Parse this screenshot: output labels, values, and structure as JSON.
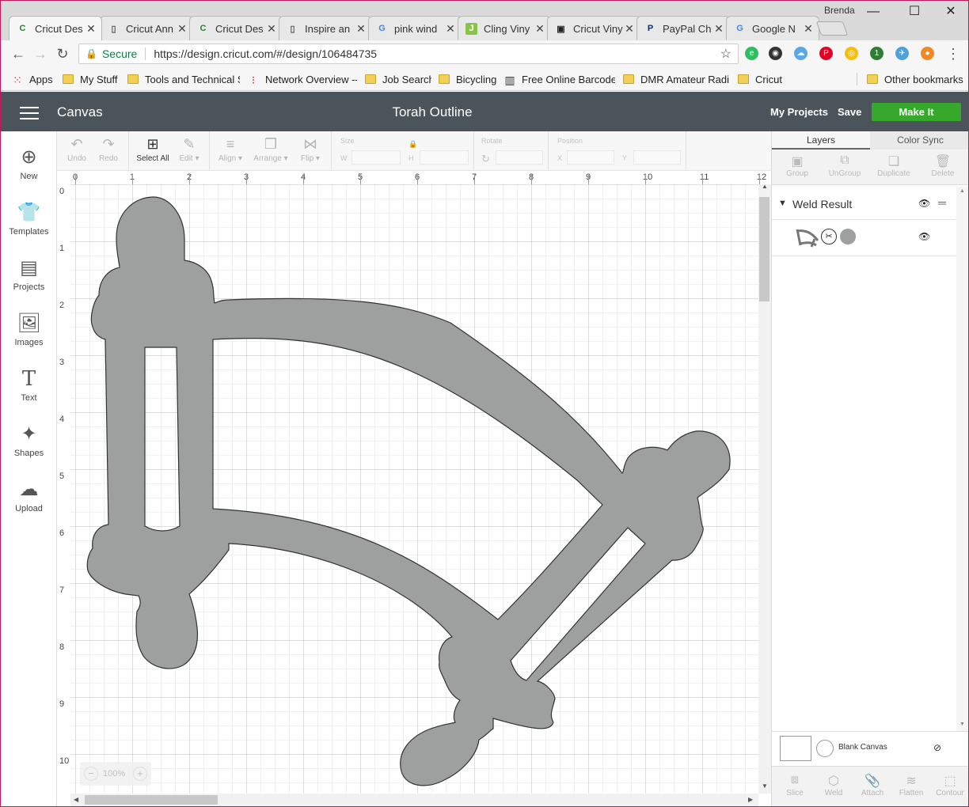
{
  "browser": {
    "user_name": "Brenda",
    "tabs": [
      {
        "title": "Cricut Des",
        "active": true,
        "favicon": "cricut-icon"
      },
      {
        "title": "Cricut Ann",
        "favicon": "document-icon"
      },
      {
        "title": "Cricut Des",
        "favicon": "cricut-icon"
      },
      {
        "title": "Inspire an",
        "favicon": "document-icon"
      },
      {
        "title": "pink wind",
        "favicon": "google-icon"
      },
      {
        "title": "Cling Viny",
        "favicon": "j-icon"
      },
      {
        "title": "Cricut Viny",
        "favicon": "site-icon"
      },
      {
        "title": "PayPal Ch",
        "favicon": "paypal-icon"
      },
      {
        "title": "Google N",
        "favicon": "google-icon"
      }
    ],
    "address": {
      "secure_label": "Secure",
      "url": "https://design.cricut.com/#/design/106484735"
    },
    "extension_badge": "1",
    "bookmarks": [
      {
        "label": "Apps",
        "icon": "apps-grid-icon"
      },
      {
        "label": "My Stuff",
        "icon": "folder-icon"
      },
      {
        "label": "Tools and Technical S",
        "icon": "folder-icon"
      },
      {
        "label": "Network Overview --",
        "icon": "traffic-light-icon"
      },
      {
        "label": "Job Search",
        "icon": "folder-icon"
      },
      {
        "label": "Bicycling",
        "icon": "folder-icon"
      },
      {
        "label": "Free Online Barcode",
        "icon": "barcode-icon"
      },
      {
        "label": "DMR Amateur Radio",
        "icon": "folder-icon"
      },
      {
        "label": "Cricut",
        "icon": "folder-icon"
      }
    ],
    "other_bookmarks": "Other bookmarks"
  },
  "app": {
    "section": "Canvas",
    "project_title": "Torah Outline",
    "my_projects": "My Projects",
    "save": "Save",
    "make_it": "Make It",
    "make_it_color": "#36a82b",
    "header_color": "#4b545a"
  },
  "left_nav": [
    {
      "label": "New",
      "icon": "plus-circle-icon"
    },
    {
      "label": "Templates",
      "icon": "tshirt-icon"
    },
    {
      "label": "Projects",
      "icon": "notebook-icon"
    },
    {
      "label": "Images",
      "icon": "image-icon"
    },
    {
      "label": "Text",
      "icon": "text-icon"
    },
    {
      "label": "Shapes",
      "icon": "shapes-icon"
    },
    {
      "label": "Upload",
      "icon": "cloud-upload-icon"
    }
  ],
  "edit_toolbar": {
    "undo": "Undo",
    "redo": "Redo",
    "select_all": "Select All",
    "edit": "Edit",
    "align": "Align",
    "arrange": "Arrange",
    "flip": "Flip",
    "size": "Size",
    "w": "W",
    "h": "H",
    "rotate": "Rotate",
    "position": "Position",
    "x": "X",
    "y": "Y"
  },
  "rulers": {
    "top": [
      "0",
      "1",
      "2",
      "3",
      "4",
      "5",
      "6",
      "7",
      "8",
      "9",
      "10",
      "11",
      "12"
    ],
    "left": [
      "0",
      "1",
      "2",
      "3",
      "4",
      "5",
      "6",
      "7",
      "8",
      "9",
      "10"
    ]
  },
  "zoom": {
    "value": "100%",
    "minus": "−",
    "plus": "+"
  },
  "right_panel": {
    "tabs": [
      "Layers",
      "Color Sync"
    ],
    "tools": [
      "Group",
      "UnGroup",
      "Duplicate",
      "Delete"
    ],
    "layer_group": "Weld Result",
    "blank_canvas": "Blank Canvas",
    "bottom_tools": [
      "Slice",
      "Weld",
      "Attach",
      "Flatten",
      "Contour"
    ],
    "shape_color": "#9ea0a0"
  }
}
